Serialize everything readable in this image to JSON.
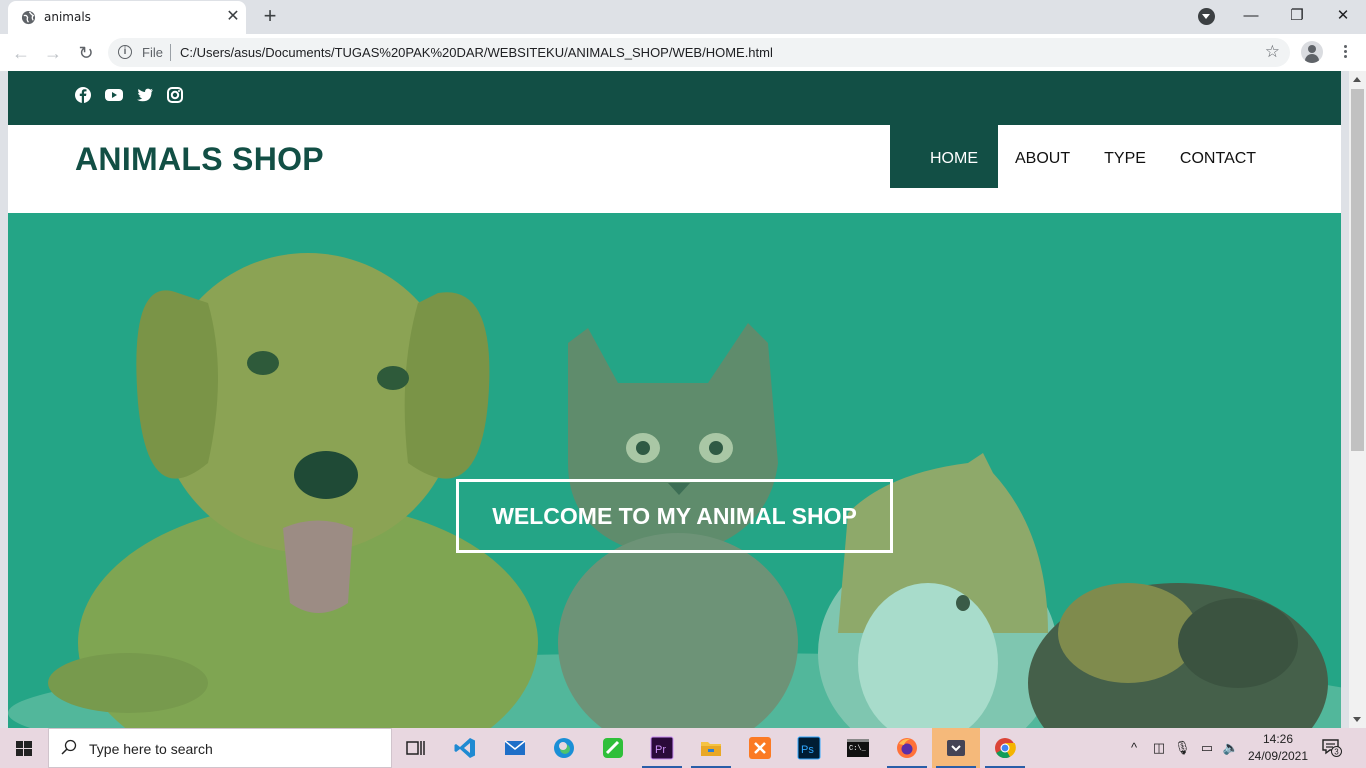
{
  "browser": {
    "tab_title": "animals",
    "url_scheme_label": "File",
    "url": "C:/Users/asus/Documents/TUGAS%20PAK%20DAR/WEBSITEKU/ANIMALS_SHOP/WEB/HOME.html"
  },
  "page": {
    "brand": "ANIMALS SHOP",
    "nav": [
      {
        "label": "HOME",
        "active": true
      },
      {
        "label": "ABOUT",
        "active": false
      },
      {
        "label": "TYPE",
        "active": false
      },
      {
        "label": "CONTACT",
        "active": false
      }
    ],
    "social_icons": [
      "facebook-icon",
      "youtube-icon",
      "twitter-icon",
      "instagram-icon"
    ],
    "hero_text": "WELCOME TO MY ANIMAL SHOP",
    "colors": {
      "primary": "#124f45",
      "hero_overlay": "#22a585"
    }
  },
  "taskbar": {
    "search_placeholder": "Type here to search",
    "time": "14:26",
    "date": "24/09/2021",
    "notification_count": "3",
    "apps": [
      "task-view-icon",
      "vscode-icon",
      "mail-icon",
      "edge-icon",
      "app-green-icon",
      "premiere-icon",
      "file-explorer-icon",
      "xampp-icon",
      "photoshop-icon",
      "terminal-icon",
      "firefox-icon",
      "app-active-icon",
      "chrome-icon"
    ]
  }
}
